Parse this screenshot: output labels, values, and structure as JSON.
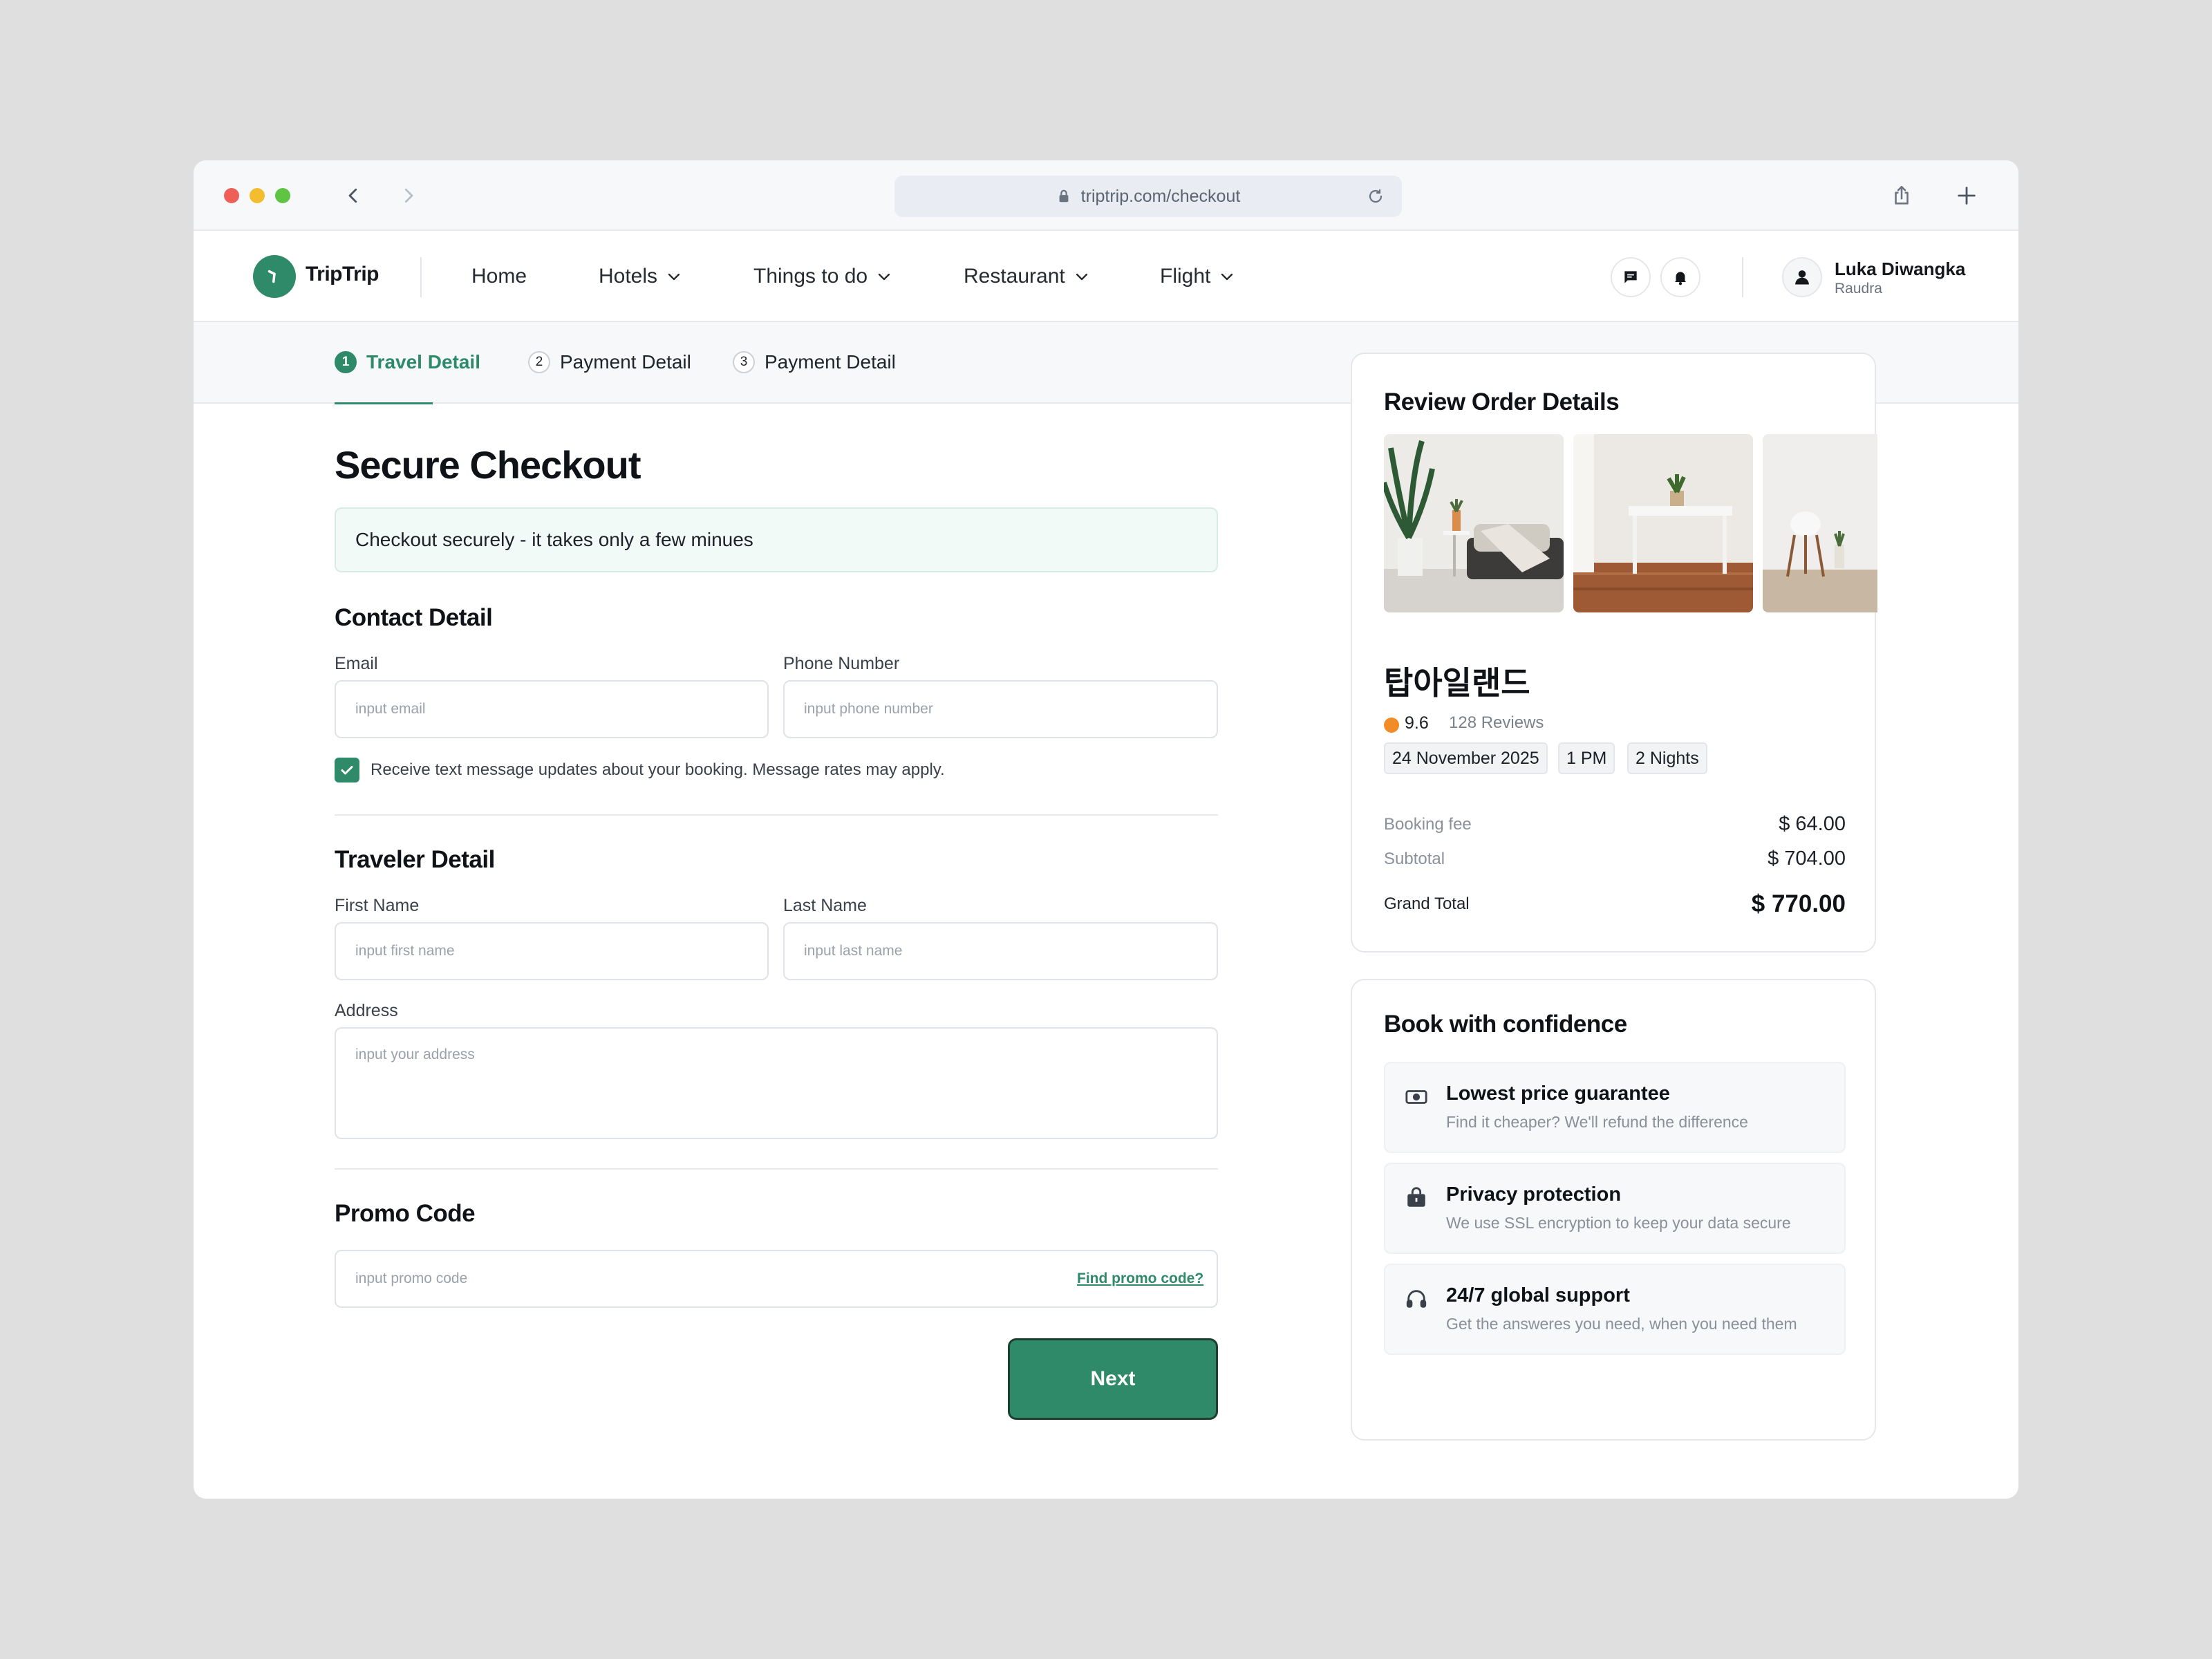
{
  "browser": {
    "url": "triptrip.com/checkout"
  },
  "header": {
    "logo": "TripTrip",
    "menu": [
      "Home",
      "Hotels",
      "Things to do",
      "Restaurant",
      "Flight"
    ],
    "user": {
      "name": "Luka Diwangka",
      "subtitle": "Raudra"
    }
  },
  "steps": [
    {
      "num": "1",
      "label": "Travel Detail"
    },
    {
      "num": "2",
      "label": "Payment Detail"
    },
    {
      "num": "3",
      "label": "Payment Detail"
    }
  ],
  "form": {
    "title": "Secure Checkout",
    "banner": "Checkout securely - it takes only a few minues",
    "contact": {
      "title": "Contact Detail",
      "email_label": "Email",
      "email_placeholder": "input email",
      "phone_label": "Phone Number",
      "phone_placeholder": "input phone number",
      "sms_label": "Receive text message updates about your booking. Message rates may apply.",
      "sms_checked": true
    },
    "traveler": {
      "title": "Traveler Detail",
      "first_label": "First Name",
      "first_placeholder": "input first name",
      "last_label": "Last Name",
      "last_placeholder": "input last name",
      "address_label": "Address",
      "address_placeholder": "input your address"
    },
    "promo": {
      "title": "Promo Code",
      "placeholder": "input promo code",
      "link": "Find promo code?"
    },
    "next_label": "Next"
  },
  "order": {
    "title": "Review Order Details",
    "hotel_name": "탑아일랜드",
    "rating": "9.6",
    "reviews": "128 Reviews",
    "chips": [
      "24 November 2025",
      "1 PM",
      "2 Nights"
    ],
    "booking_fee_label": "Booking fee",
    "booking_fee": "$ 64.00",
    "subtotal_label": "Subtotal",
    "subtotal": "$ 704.00",
    "grand_total_label": "Grand Total",
    "grand_total": "$ 770.00"
  },
  "confidence": {
    "title": "Book with confidence",
    "items": [
      {
        "icon": "cash-icon",
        "title": "Lowest price guarantee",
        "desc": "Find it cheaper? We'll refund the difference"
      },
      {
        "icon": "lock-bag-icon",
        "title": "Privacy protection",
        "desc": "We use SSL encryption to keep your data secure"
      },
      {
        "icon": "headset-icon",
        "title": "24/7 global support",
        "desc": "Get the answeres you need, when you need them"
      }
    ]
  },
  "colors": {
    "accent": "#2e8a69",
    "rating": "#f28c28",
    "banner_bg": "#f1faf7"
  }
}
